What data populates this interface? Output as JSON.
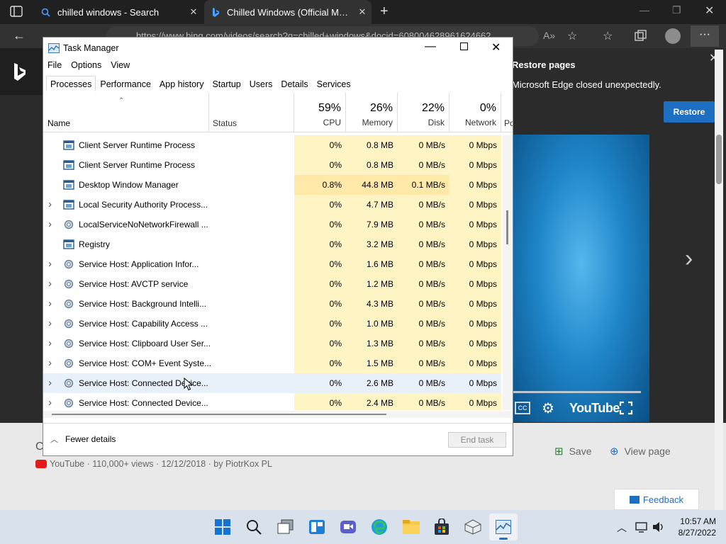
{
  "browser": {
    "tabs": [
      {
        "title": "chilled windows - Search"
      },
      {
        "title": "Chilled Windows (Official Music Video)"
      }
    ],
    "address": "https://www.bing.com/videos/search?q=chilled+windows&docid=608004628961624662..."
  },
  "restore_prompt": {
    "title": "Restore pages",
    "message": "Microsoft Edge closed unexpectedly.",
    "button": "Restore"
  },
  "video": {
    "brand": "YouTube",
    "meta": "YouTube · 110,000+ views · 12/12/2018 · by PiotrKox PL",
    "save_label": "Save",
    "view_page_label": "View page",
    "feedback_label": "Feedback"
  },
  "task_manager": {
    "title": "Task Manager",
    "menu": [
      "File",
      "Options",
      "View"
    ],
    "tabs": [
      "Processes",
      "Performance",
      "App history",
      "Startup",
      "Users",
      "Details",
      "Services"
    ],
    "columns": {
      "name": "Name",
      "status": "Status",
      "cpu": {
        "pct": "59%",
        "label": "CPU"
      },
      "memory": {
        "pct": "26%",
        "label": "Memory"
      },
      "disk": {
        "pct": "22%",
        "label": "Disk"
      },
      "network": {
        "pct": "0%",
        "label": "Network"
      },
      "power": "Po"
    },
    "rows": [
      {
        "name": "Client Server Runtime Process",
        "expandable": false,
        "icon": "window-icon",
        "cpu": "0%",
        "mem": "0.8 MB",
        "disk": "0 MB/s",
        "net": "0 Mbps"
      },
      {
        "name": "Client Server Runtime Process",
        "expandable": false,
        "icon": "window-icon",
        "cpu": "0%",
        "mem": "0.8 MB",
        "disk": "0 MB/s",
        "net": "0 Mbps"
      },
      {
        "name": "Desktop Window Manager",
        "expandable": false,
        "icon": "window-icon",
        "cpu": "0.8%",
        "mem": "44.8 MB",
        "disk": "0.1 MB/s",
        "net": "0 Mbps"
      },
      {
        "name": "Local Security Authority Process...",
        "expandable": true,
        "icon": "window-icon",
        "cpu": "0%",
        "mem": "4.7 MB",
        "disk": "0 MB/s",
        "net": "0 Mbps"
      },
      {
        "name": "LocalServiceNoNetworkFirewall ...",
        "expandable": true,
        "icon": "gear-icon",
        "cpu": "0%",
        "mem": "7.9 MB",
        "disk": "0 MB/s",
        "net": "0 Mbps"
      },
      {
        "name": "Registry",
        "expandable": false,
        "icon": "window-icon",
        "cpu": "0%",
        "mem": "3.2 MB",
        "disk": "0 MB/s",
        "net": "0 Mbps"
      },
      {
        "name": "Service Host: Application Infor...",
        "expandable": true,
        "icon": "gear-icon",
        "cpu": "0%",
        "mem": "1.6 MB",
        "disk": "0 MB/s",
        "net": "0 Mbps"
      },
      {
        "name": "Service Host: AVCTP service",
        "expandable": true,
        "icon": "gear-icon",
        "cpu": "0%",
        "mem": "1.2 MB",
        "disk": "0 MB/s",
        "net": "0 Mbps"
      },
      {
        "name": "Service Host: Background Intelli...",
        "expandable": true,
        "icon": "gear-icon",
        "cpu": "0%",
        "mem": "4.3 MB",
        "disk": "0 MB/s",
        "net": "0 Mbps"
      },
      {
        "name": "Service Host: Capability Access ...",
        "expandable": true,
        "icon": "gear-icon",
        "cpu": "0%",
        "mem": "1.0 MB",
        "disk": "0 MB/s",
        "net": "0 Mbps"
      },
      {
        "name": "Service Host: Clipboard User Ser...",
        "expandable": true,
        "icon": "gear-icon",
        "cpu": "0%",
        "mem": "1.3 MB",
        "disk": "0 MB/s",
        "net": "0 Mbps"
      },
      {
        "name": "Service Host: COM+ Event Syste...",
        "expandable": true,
        "icon": "gear-icon",
        "cpu": "0%",
        "mem": "1.5 MB",
        "disk": "0 MB/s",
        "net": "0 Mbps"
      },
      {
        "name": "Service Host: Connected Device...",
        "expandable": true,
        "icon": "gear-icon",
        "cpu": "0%",
        "mem": "2.6 MB",
        "disk": "0 MB/s",
        "net": "0 Mbps",
        "hovered": true
      },
      {
        "name": "Service Host: Connected Device...",
        "expandable": true,
        "icon": "gear-icon",
        "cpu": "0%",
        "mem": "2.4 MB",
        "disk": "0 MB/s",
        "net": "0 Mbps"
      }
    ],
    "fewer_details": "Fewer details",
    "end_task": "End task"
  },
  "clock": {
    "time": "10:57 AM",
    "date": "8/27/2022"
  },
  "colors": {
    "heat_light": "#fff4c4",
    "heat_medium": "#ffe9a8",
    "accent": "#1e6fc2"
  }
}
